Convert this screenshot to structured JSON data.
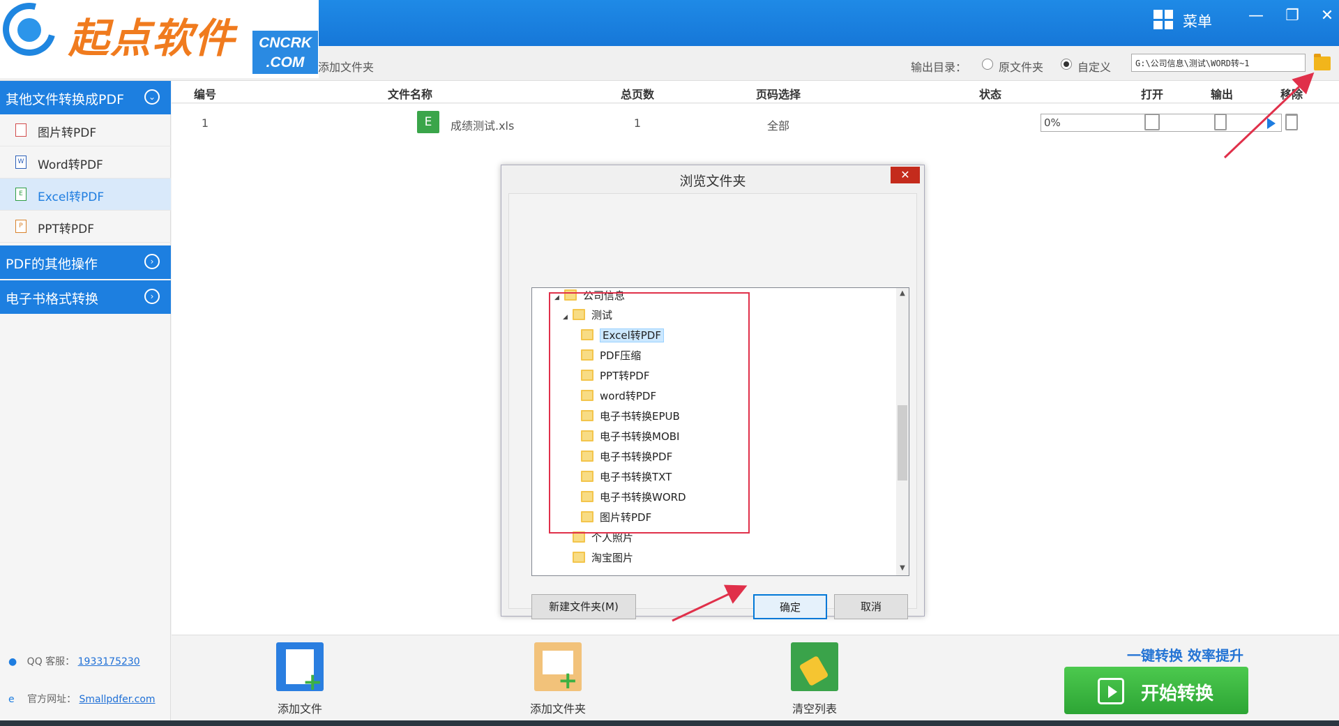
{
  "app": {
    "logo_text": "起点软件",
    "logo_badge_top": "CNCRK",
    "logo_badge_bottom": ".COM",
    "menu_label": "菜单",
    "win_minimize": "—",
    "win_restore": "❐",
    "win_close": "✕"
  },
  "toolbar": {
    "add_folder_label": "添加文件夹",
    "output_dir_label": "输出目录：",
    "radio_original": "原文件夹",
    "radio_custom": "自定义",
    "radio_selected": "自定义",
    "output_path": "G:\\公司信息\\测试\\WORD转~1"
  },
  "sidebar": {
    "groups": [
      {
        "label": "其他文件转换成PDF",
        "state": "expanded"
      },
      {
        "label": "PDF的其他操作",
        "state": "collapsed"
      },
      {
        "label": "电子书格式转换",
        "state": "collapsed"
      }
    ],
    "items": [
      {
        "label": "图片转PDF",
        "icon": "image-file-icon"
      },
      {
        "label": "Word转PDF",
        "icon": "word-file-icon"
      },
      {
        "label": "Excel转PDF",
        "icon": "excel-file-icon",
        "active": true
      },
      {
        "label": "PPT转PDF",
        "icon": "ppt-file-icon"
      }
    ],
    "qq_label": "QQ 客服：",
    "qq_value": "1933175230",
    "site_label": "官方网址：",
    "site_value": "Smallpdfer.com"
  },
  "table": {
    "headers": [
      "编号",
      "文件名称",
      "总页数",
      "页码选择",
      "状态",
      "打开",
      "输出",
      "移除"
    ],
    "rows": [
      {
        "index": "1",
        "file_icon_letter": "E",
        "filename": "成绩测试.xls",
        "pages": "1",
        "page_select": "全部",
        "progress": "0%"
      }
    ]
  },
  "dialog": {
    "title": "浏览文件夹",
    "close": "✕",
    "tree": [
      {
        "label": "公司信息",
        "expanded": true
      },
      {
        "label": "测试",
        "expanded": true
      },
      {
        "label": "Excel转PDF",
        "selected": true
      },
      {
        "label": "PDF压缩"
      },
      {
        "label": "PPT转PDF"
      },
      {
        "label": "word转PDF"
      },
      {
        "label": "电子书转换EPUB"
      },
      {
        "label": "电子书转换MOBI"
      },
      {
        "label": "电子书转换PDF"
      },
      {
        "label": "电子书转换TXT"
      },
      {
        "label": "电子书转换WORD"
      },
      {
        "label": "图片转PDF"
      },
      {
        "label": "个人照片"
      },
      {
        "label": "淘宝图片"
      }
    ],
    "new_folder_label": "新建文件夹(M)",
    "ok_label": "确定",
    "cancel_label": "取消"
  },
  "bottom": {
    "add_file_label": "添加文件",
    "add_folder_label": "添加文件夹",
    "clear_list_label": "清空列表",
    "slogan": "一键转换  效率提升",
    "start_label": "开始转换"
  },
  "colors": {
    "brand_blue": "#1d7fe0",
    "logo_orange": "#f07b1e",
    "start_green": "#33ad3b",
    "annotation_red": "#e0304a"
  }
}
